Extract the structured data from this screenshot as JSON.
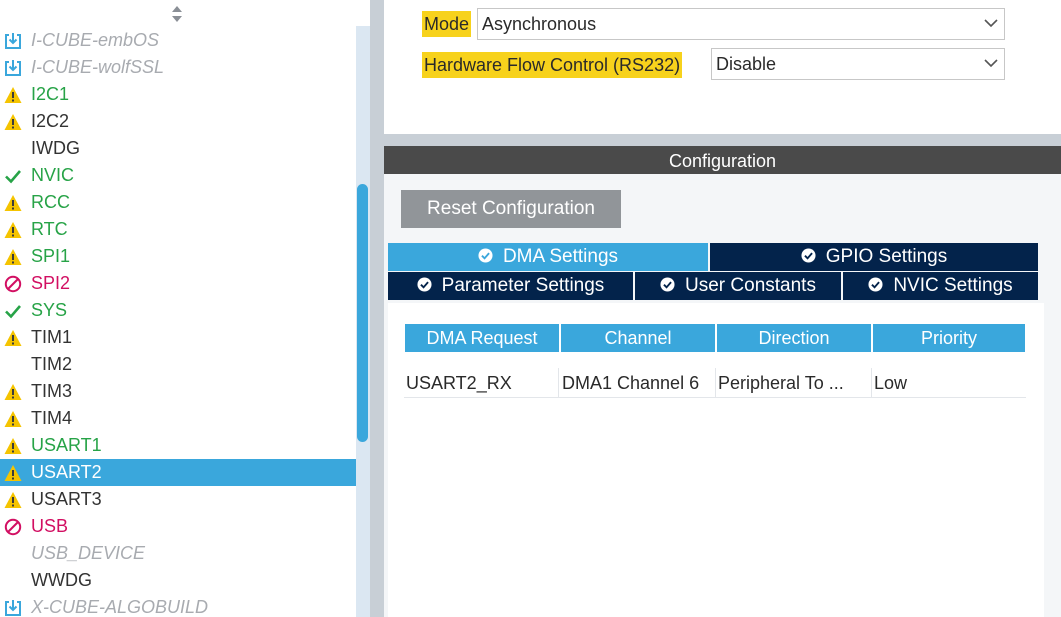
{
  "sidebar": {
    "items": [
      {
        "label": "I-CUBE-embOS",
        "status": "pack",
        "icon": "pack-download-icon"
      },
      {
        "label": "I-CUBE-wolfSSL",
        "status": "pack",
        "icon": "pack-download-icon"
      },
      {
        "label": "I2C1",
        "status": "green",
        "icon": "warning-icon"
      },
      {
        "label": "I2C2",
        "status": "black",
        "icon": "warning-icon"
      },
      {
        "label": "IWDG",
        "status": "black",
        "icon": ""
      },
      {
        "label": "NVIC",
        "status": "green",
        "icon": "check-icon"
      },
      {
        "label": "RCC",
        "status": "green",
        "icon": "warning-icon"
      },
      {
        "label": "RTC",
        "status": "green",
        "icon": "warning-icon"
      },
      {
        "label": "SPI1",
        "status": "green",
        "icon": "warning-icon"
      },
      {
        "label": "SPI2",
        "status": "red",
        "icon": "no-entry-icon"
      },
      {
        "label": "SYS",
        "status": "green",
        "icon": "check-icon"
      },
      {
        "label": "TIM1",
        "status": "black",
        "icon": "warning-icon"
      },
      {
        "label": "TIM2",
        "status": "black",
        "icon": ""
      },
      {
        "label": "TIM3",
        "status": "black",
        "icon": "warning-icon"
      },
      {
        "label": "TIM4",
        "status": "black",
        "icon": "warning-icon"
      },
      {
        "label": "USART1",
        "status": "green",
        "icon": "warning-icon"
      },
      {
        "label": "USART2",
        "status": "selected",
        "icon": "warning-icon"
      },
      {
        "label": "USART3",
        "status": "black",
        "icon": "warning-icon"
      },
      {
        "label": "USB",
        "status": "red",
        "icon": "no-entry-icon"
      },
      {
        "label": "USB_DEVICE",
        "status": "gray",
        "icon": ""
      },
      {
        "label": "WWDG",
        "status": "black",
        "icon": ""
      },
      {
        "label": "X-CUBE-ALGOBUILD",
        "status": "pack",
        "icon": "pack-download-icon"
      }
    ]
  },
  "params": {
    "mode_label": "Mode",
    "mode_value": "Asynchronous",
    "flow_label": "Hardware Flow Control (RS232)",
    "flow_value": "Disable"
  },
  "config": {
    "header": "Configuration",
    "reset_label": "Reset Configuration",
    "tabs": {
      "dma": "DMA Settings",
      "gpio": "GPIO Settings",
      "parameter": "Parameter Settings",
      "user": "User Constants",
      "nvic": "NVIC Settings"
    },
    "active_tab": "DMA Settings"
  },
  "dma_table": {
    "headers": [
      "DMA Request",
      "Channel",
      "Direction",
      "Priority"
    ],
    "rows": [
      [
        "USART2_RX",
        "DMA1 Channel 6",
        "Peripheral To ...",
        "Low"
      ]
    ]
  },
  "colors": {
    "accent": "#3aa7dc",
    "dark_tab": "#03234b",
    "highlight": "#f7d21c",
    "ok_green": "#27a347",
    "error_red": "#d20f62",
    "warning_yellow": "#f5c400"
  }
}
